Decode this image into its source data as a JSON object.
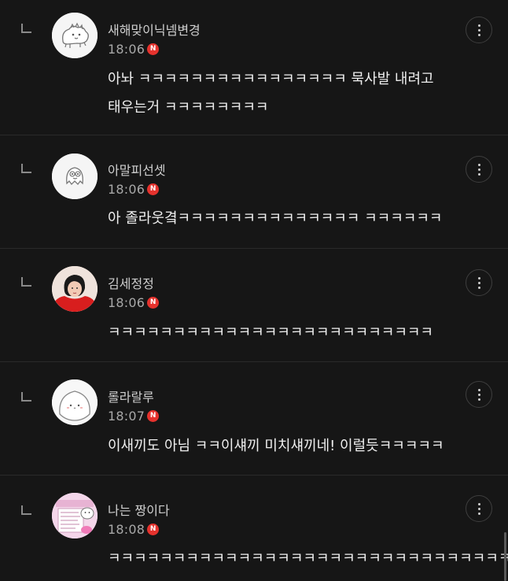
{
  "new_badge_label": "N",
  "comments": [
    {
      "nickname": "새해맞이닉넴변경",
      "time": "18:06",
      "lines": [
        "아놔 ㅋㅋㅋㅋㅋㅋㅋㅋㅋㅋㅋㅋㅋㅋㅋㅋ 묵사발 내려고",
        "태우는거 ㅋㅋㅋㅋㅋㅋㅋㅋ"
      ],
      "avatar_icon": "dinosaur-doodle-icon"
    },
    {
      "nickname": "아말피선셋",
      "time": "18:06",
      "lines": [
        "아 졸라웃곀ㅋㅋㅋㅋㅋㅋㅋㅋㅋㅋㅋㅋㅋㅋ ㅋㅋㅋㅋㅋㅋ"
      ],
      "avatar_icon": "ghost-doodle-icon"
    },
    {
      "nickname": "김세정정",
      "time": "18:06",
      "lines": [
        "ㅋㅋㅋㅋㅋㅋㅋㅋㅋㅋㅋㅋㅋㅋㅋㅋㅋㅋㅋㅋㅋㅋㅋㅋㅋ"
      ],
      "avatar_icon": "person-photo-icon"
    },
    {
      "nickname": "롤라랄루",
      "time": "18:07",
      "lines": [
        "이새끼도 아님 ㅋㅋ이섀끼 미치섀끼네! 이럴듯ㅋㅋㅋㅋㅋ"
      ],
      "avatar_icon": "round-character-icon"
    },
    {
      "nickname": "나는 짱이다",
      "time": "18:08",
      "lines": [
        "ㅋㅋㅋㅋㅋㅋㅋㅋㅋㅋㅋㅋㅋㅋㅋㅋㅋㅋㅋㅋㅋㅋㅋㅋㅋㅋㅋㅋㅋㅋㅋ"
      ],
      "avatar_icon": "memo-sticker-icon"
    }
  ],
  "colors": {
    "background": "#161616",
    "divider": "#2a2a2a",
    "new_badge": "#e5322d",
    "nickname": "#cfcfcf",
    "time": "#a8a8a8",
    "body_text": "#efefef"
  }
}
